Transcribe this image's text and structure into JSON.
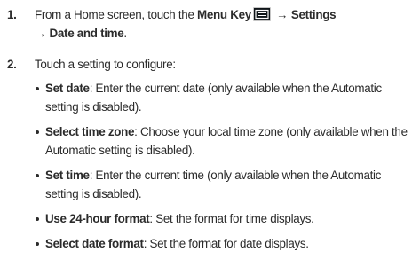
{
  "steps": [
    {
      "number": "1.",
      "text_1": "From a Home screen, touch the ",
      "bold_1": "Menu Key",
      "arrow_1": " → ",
      "bold_2": "Settings",
      "arrow_2": "→ ",
      "bold_3": "Date and time",
      "text_end": "."
    },
    {
      "number": "2.",
      "text": "Touch a setting to configure:",
      "bullets": [
        {
          "term": "Set date",
          "desc": ": Enter the current date (only available when the Automatic setting is disabled)."
        },
        {
          "term": "Select time zone",
          "desc": ": Choose your local time zone (only available when the Automatic setting is disabled)."
        },
        {
          "term": "Set time",
          "desc": ": Enter the current time (only available when the Automatic setting is disabled)."
        },
        {
          "term": "Use 24-hour format",
          "desc": ": Set the format for time displays."
        },
        {
          "term": "Select date format",
          "desc": ": Set the format for date displays."
        }
      ]
    }
  ],
  "icons": {
    "menu_key": "menu-key-icon"
  }
}
